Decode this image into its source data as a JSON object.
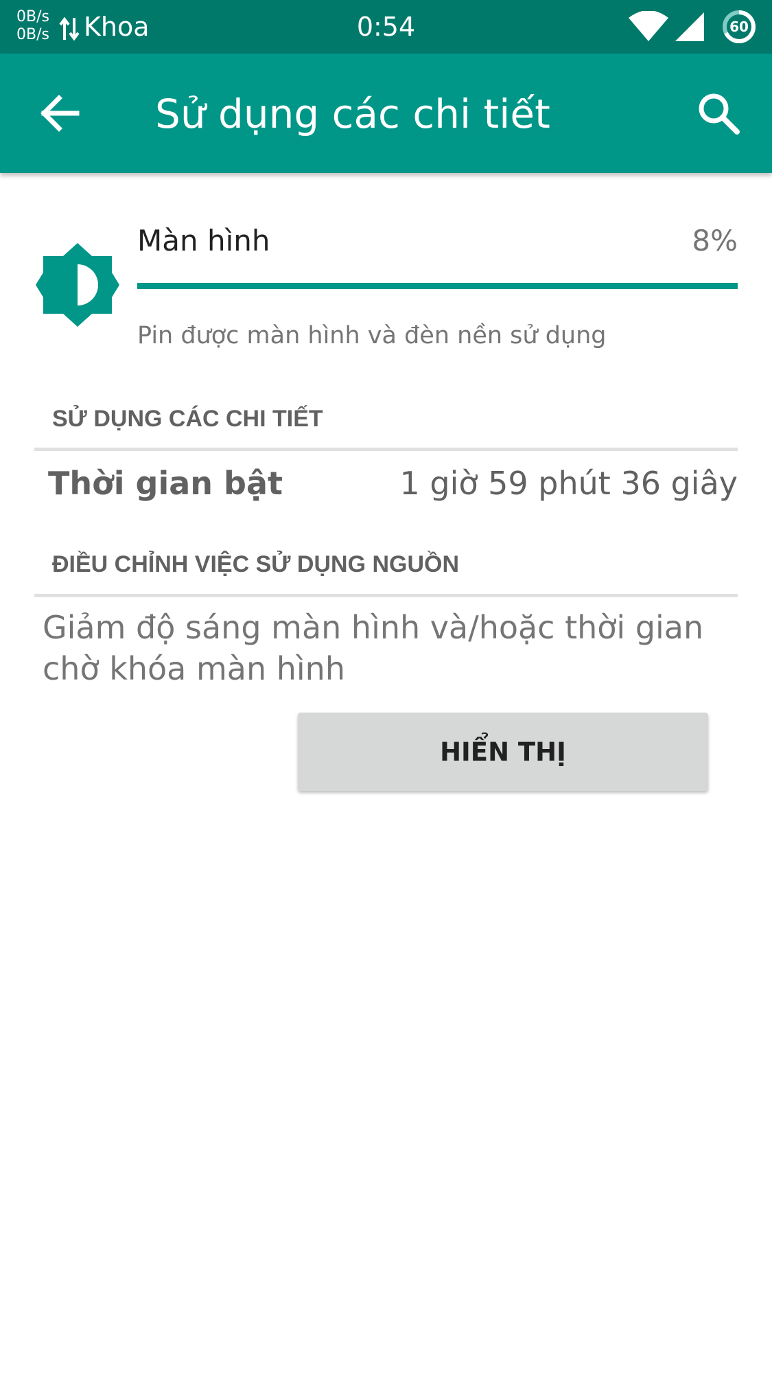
{
  "status_bar": {
    "net_up": "0B/s",
    "net_down": "0B/s",
    "carrier": "Khoa",
    "time": "0:54",
    "battery_level": "60",
    "icons": [
      "data-transfer-icon",
      "wifi-icon",
      "signal-icon",
      "battery-icon"
    ]
  },
  "app_bar": {
    "title": "Sử dụng các chi tiết",
    "icons": [
      "back-arrow-icon",
      "search-icon"
    ],
    "color": "#009688"
  },
  "usage_item": {
    "icon": "brightness-icon",
    "title": "Màn hình",
    "percent_label": "8%",
    "bar_fraction": 1.0,
    "summary": "Pin được màn hình và đèn nền sử dụng"
  },
  "details_section": {
    "header": "SỬ DỤNG CÁC CHI TIẾT",
    "label": "Thời gian bật",
    "value": "1 giờ 59 phút 36 giây"
  },
  "adjust_section": {
    "header": "ĐIỀU CHỈNH VIỆC SỬ DỤNG NGUỒN",
    "text": "Giảm độ sáng màn hình và/hoặc thời gian chờ khóa màn hình",
    "button_label": "HIỂN THỊ"
  },
  "colors": {
    "status_bar": "#00796b",
    "accent": "#009688",
    "button": "#d6d7d7"
  }
}
